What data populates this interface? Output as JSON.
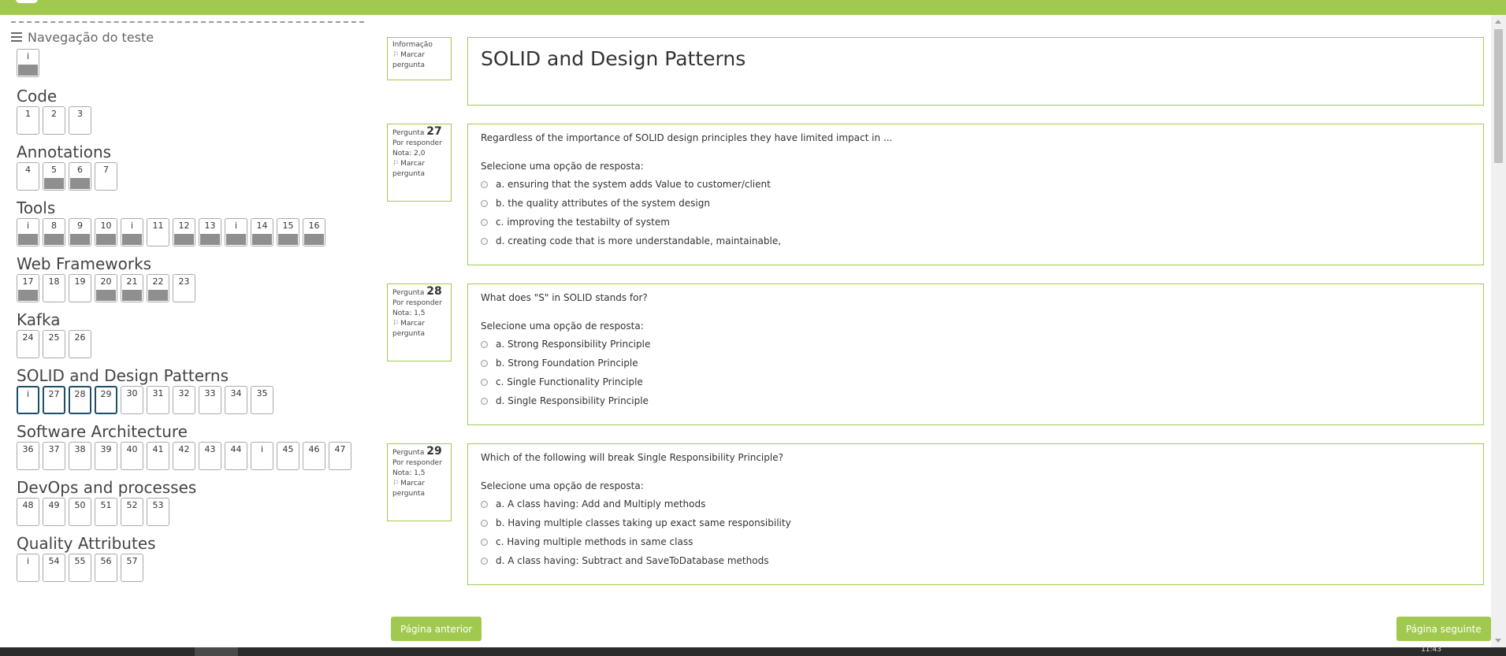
{
  "nav": {
    "title": "Navegação do teste",
    "info_label": "i",
    "sections": [
      {
        "title": "Code",
        "buttons": [
          {
            "label": "1",
            "state": "empty"
          },
          {
            "label": "2",
            "state": "empty"
          },
          {
            "label": "3",
            "state": "empty"
          }
        ]
      },
      {
        "title": "Annotations",
        "buttons": [
          {
            "label": "4",
            "state": "empty"
          },
          {
            "label": "5",
            "state": "done"
          },
          {
            "label": "6",
            "state": "done"
          },
          {
            "label": "7",
            "state": "empty"
          }
        ]
      },
      {
        "title": "Tools",
        "buttons": [
          {
            "label": "i",
            "state": "info"
          },
          {
            "label": "8",
            "state": "done"
          },
          {
            "label": "9",
            "state": "done"
          },
          {
            "label": "10",
            "state": "done"
          },
          {
            "label": "i",
            "state": "info"
          },
          {
            "label": "11",
            "state": "empty"
          },
          {
            "label": "12",
            "state": "done"
          },
          {
            "label": "13",
            "state": "done"
          },
          {
            "label": "i",
            "state": "info"
          },
          {
            "label": "14",
            "state": "done"
          },
          {
            "label": "15",
            "state": "done"
          },
          {
            "label": "16",
            "state": "done"
          }
        ]
      },
      {
        "title": "Web Frameworks",
        "buttons": [
          {
            "label": "17",
            "state": "done"
          },
          {
            "label": "18",
            "state": "empty"
          },
          {
            "label": "19",
            "state": "empty"
          },
          {
            "label": "20",
            "state": "done"
          },
          {
            "label": "21",
            "state": "done"
          },
          {
            "label": "22",
            "state": "done"
          },
          {
            "label": "23",
            "state": "empty"
          }
        ]
      },
      {
        "title": "Kafka",
        "buttons": [
          {
            "label": "24",
            "state": "empty"
          },
          {
            "label": "25",
            "state": "empty"
          },
          {
            "label": "26",
            "state": "empty"
          }
        ]
      },
      {
        "title": "SOLID and Design Patterns",
        "buttons": [
          {
            "label": "i",
            "state": "current"
          },
          {
            "label": "27",
            "state": "current"
          },
          {
            "label": "28",
            "state": "current"
          },
          {
            "label": "29",
            "state": "current"
          },
          {
            "label": "30",
            "state": "empty"
          },
          {
            "label": "31",
            "state": "empty"
          },
          {
            "label": "32",
            "state": "empty"
          },
          {
            "label": "33",
            "state": "empty"
          },
          {
            "label": "34",
            "state": "empty"
          },
          {
            "label": "35",
            "state": "empty"
          }
        ]
      },
      {
        "title": "Software Architecture",
        "buttons": [
          {
            "label": "36",
            "state": "empty"
          },
          {
            "label": "37",
            "state": "empty"
          },
          {
            "label": "38",
            "state": "empty"
          },
          {
            "label": "39",
            "state": "empty"
          },
          {
            "label": "40",
            "state": "empty"
          },
          {
            "label": "41",
            "state": "empty"
          },
          {
            "label": "42",
            "state": "empty"
          },
          {
            "label": "43",
            "state": "empty"
          },
          {
            "label": "44",
            "state": "empty"
          },
          {
            "label": "i",
            "state": "empty"
          },
          {
            "label": "45",
            "state": "empty"
          },
          {
            "label": "46",
            "state": "empty"
          },
          {
            "label": "47",
            "state": "empty"
          }
        ]
      },
      {
        "title": "DevOps and processes",
        "buttons": [
          {
            "label": "48",
            "state": "empty"
          },
          {
            "label": "49",
            "state": "empty"
          },
          {
            "label": "50",
            "state": "empty"
          },
          {
            "label": "51",
            "state": "empty"
          },
          {
            "label": "52",
            "state": "empty"
          },
          {
            "label": "53",
            "state": "empty"
          }
        ]
      },
      {
        "title": "Quality Attributes",
        "buttons": [
          {
            "label": "i",
            "state": "empty"
          },
          {
            "label": "54",
            "state": "empty"
          },
          {
            "label": "55",
            "state": "empty"
          },
          {
            "label": "56",
            "state": "empty"
          },
          {
            "label": "57",
            "state": "empty"
          }
        ]
      }
    ]
  },
  "info_box": {
    "label": "Informação",
    "flag_label": "Marcar pergunta"
  },
  "section_heading": "SOLID and Design Patterns",
  "questions": [
    {
      "label": "Pergunta",
      "number": "27",
      "status": "Por responder",
      "grade": "Nota: 2,0",
      "flag_label": "Marcar pergunta",
      "text": "Regardless of the importance of SOLID design principles they have limited impact in ...",
      "prompt": "Selecione uma opção de resposta:",
      "options": [
        "a. ensuring that the system adds Value to customer/client",
        "b. the quality attributes of the system design",
        "c. improving the testabilty of system",
        "d. creating code that is more understandable, maintainable,"
      ]
    },
    {
      "label": "Pergunta",
      "number": "28",
      "status": "Por responder",
      "grade": "Nota: 1,5",
      "flag_label": "Marcar pergunta",
      "text": "What does \"S\" in SOLID stands for?",
      "prompt": "Selecione uma opção de resposta:",
      "options": [
        "a. Strong Responsibility Principle",
        "b. Strong Foundation Principle",
        "c. Single Functionality Principle",
        "d. Single Responsibility Principle"
      ]
    },
    {
      "label": "Pergunta",
      "number": "29",
      "status": "Por responder",
      "grade": "Nota: 1,5",
      "flag_label": "Marcar pergunta",
      "text": "Which of the following will break Single Responsibility Principle?",
      "prompt": "Selecione uma opção de resposta:",
      "options": [
        "a. A class having: Add and Multiply methods",
        "b. Having multiple classes taking up exact same responsibility",
        "c. Having multiple methods in same class",
        "d. A class having: Subtract and SaveToDatabase methods"
      ]
    }
  ],
  "buttons": {
    "prev": "Página anterior",
    "next": "Página seguinte"
  },
  "taskbar": {
    "clock": "11:43"
  },
  "colors": {
    "accent": "#a2c94f",
    "answered": "#8f8f8f",
    "current_border": "#1b4f6b"
  }
}
